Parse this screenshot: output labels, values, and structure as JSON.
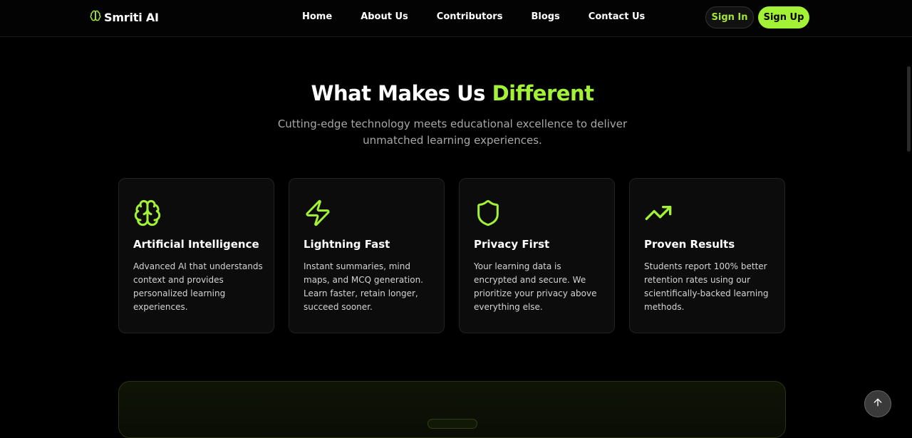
{
  "navbar": {
    "brand": "Smriti AI",
    "brand_icon": "brain-icon",
    "links": [
      "Home",
      "About Us",
      "Contributors",
      "Blogs",
      "Contact Us"
    ],
    "signin_label": "Sign In",
    "signup_label": "Sign Up"
  },
  "features": {
    "title": "What Makes Us",
    "title_accent": "Different",
    "subtitle": "Cutting-edge technology meets educational excellence to deliver unmatched learning experiences.",
    "cards": [
      {
        "icon": "brain-icon",
        "title": "Artificial Intelligence",
        "description": "Advanced AI that understands context and provides personalized learning experiences."
      },
      {
        "icon": "lightning-icon",
        "title": "Lightning Fast",
        "description": "Instant summaries, mind maps, and MCQ generation. Learn faster, retain longer, succeed sooner."
      },
      {
        "icon": "shield-icon",
        "title": "Privacy First",
        "description": "Your learning data is encrypted and secure. We prioritize your privacy above everything else."
      },
      {
        "icon": "trending-up-icon",
        "title": "Proven Results",
        "description": "Students report 100% better retention rates using our scientifically-backed learning methods."
      }
    ]
  },
  "colors": {
    "accent": "#a3f235",
    "background": "#000000",
    "card_background": "#0c0c0c"
  },
  "back_to_top_icon": "arrow-up-icon"
}
